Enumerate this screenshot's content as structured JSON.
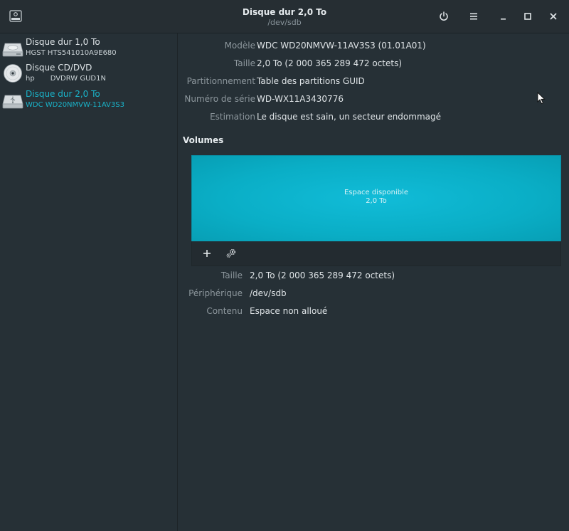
{
  "window": {
    "title": "Disque dur 2,0 To",
    "subtitle": "/dev/sdb"
  },
  "header_icons": [
    "disks-app-icon",
    "power-icon",
    "menu-icon",
    "minimize-icon",
    "maximize-icon",
    "close-icon"
  ],
  "sidebar": {
    "items": [
      {
        "name": "Disque dur 1,0 To",
        "sub1": "HGST HTS541010A9E680",
        "sub2": "",
        "icon": "hard-drive-icon",
        "selected": false
      },
      {
        "name": "Disque CD/DVD",
        "sub1": "hp",
        "sub2": "DVDRW GUD1N",
        "icon": "optical-disc-icon",
        "selected": false
      },
      {
        "name": "Disque dur 2,0 To",
        "sub1": "WDC WD20NMVW-11AV3S3",
        "sub2": "",
        "icon": "usb-drive-icon",
        "selected": true
      }
    ]
  },
  "disk_info": {
    "model_label": "Modèle",
    "model_value": "WDC WD20NMVW-11AV3S3 (01.01A01)",
    "size_label": "Taille",
    "size_value": "2,0 To (2 000 365 289 472 octets)",
    "partitioning_label": "Partitionnement",
    "partitioning_value": "Table des partitions GUID",
    "serial_label": "Numéro de série",
    "serial_value": "WD-WX11A3430776",
    "assessment_label": "Estimation",
    "assessment_value": "Le disque est sain, un secteur endommagé"
  },
  "volumes": {
    "heading": "Volumes",
    "graph_label": "Espace disponible",
    "graph_size": "2,0 To",
    "accent_color": "#0fb5cf",
    "toolbar_icons": [
      "add-partition-icon",
      "partition-settings-icon"
    ],
    "size_label": "Taille",
    "size_value": "2,0 To (2 000 365 289 472 octets)",
    "device_label": "Périphérique",
    "device_value": "/dev/sdb",
    "contents_label": "Contenu",
    "contents_value": "Espace non alloué"
  }
}
